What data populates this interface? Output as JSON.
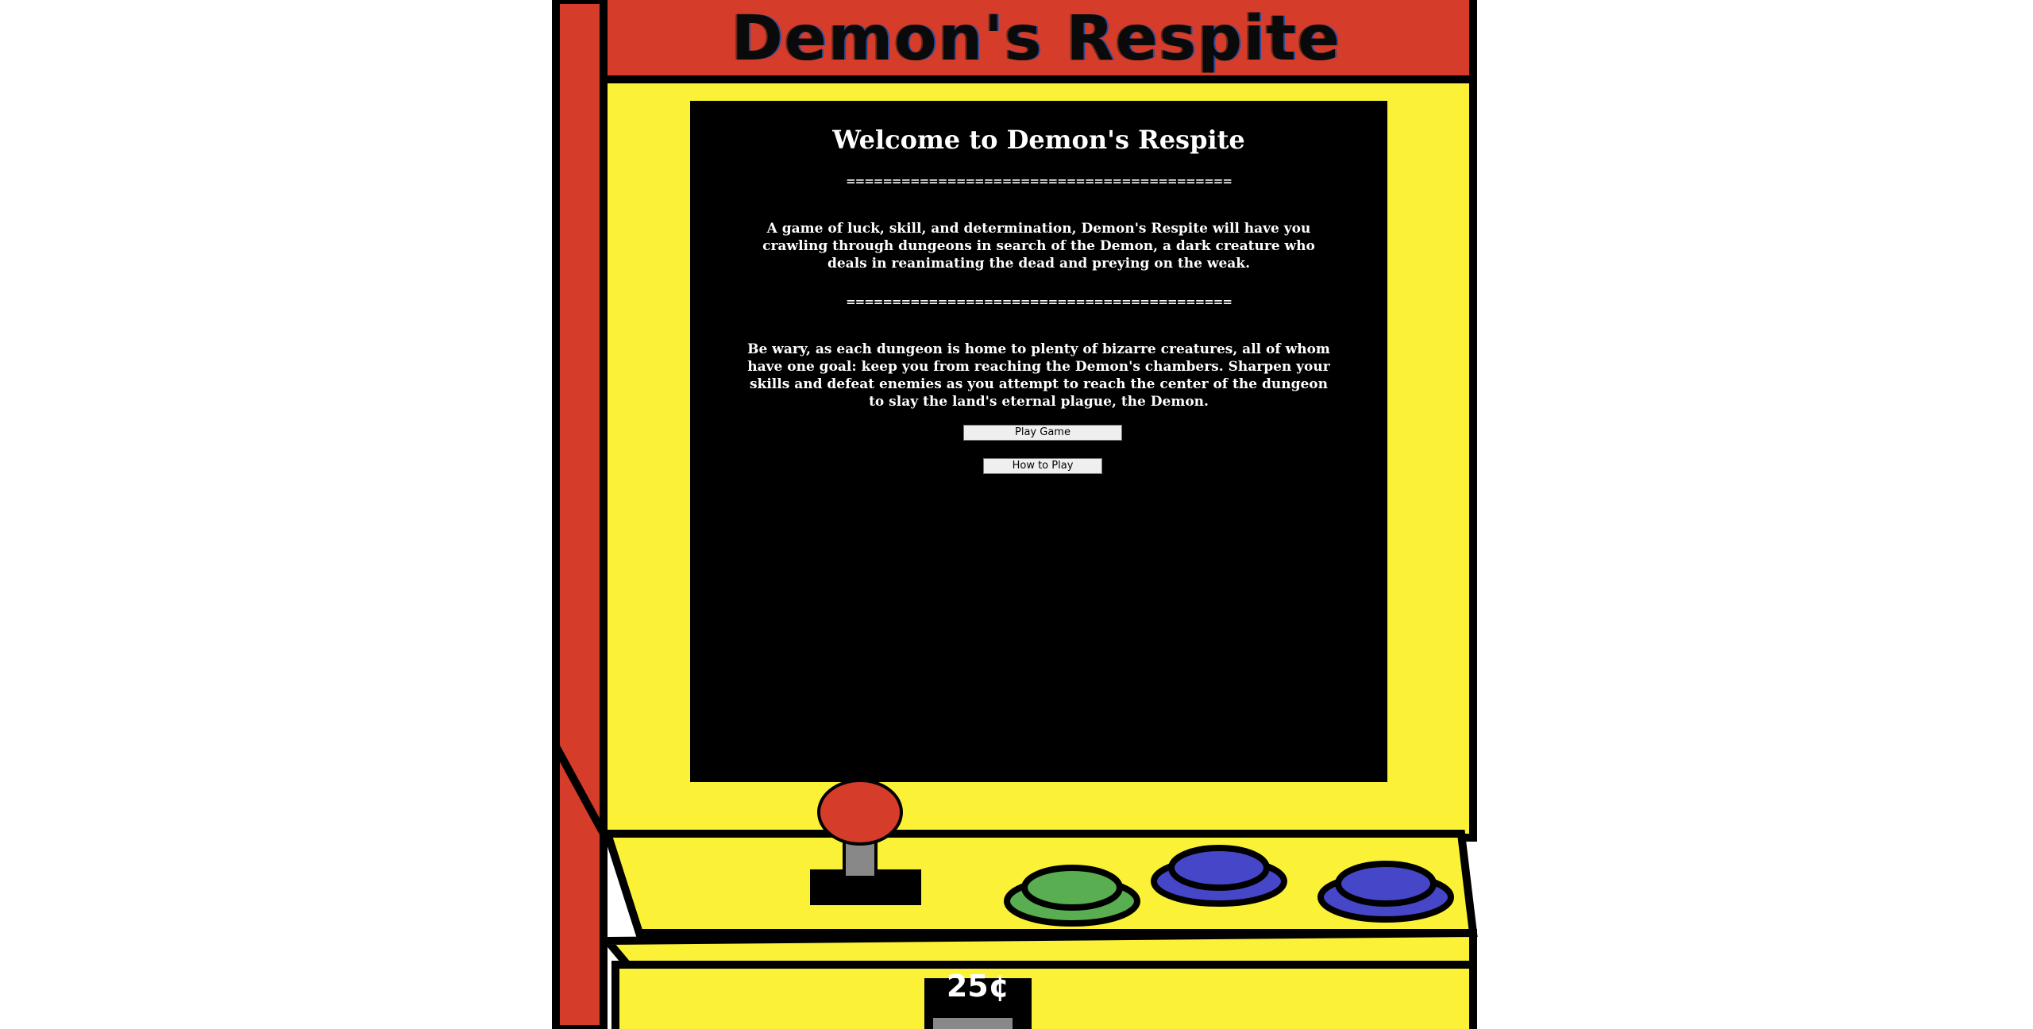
{
  "marquee": {
    "title": "Demon's Respite"
  },
  "screen": {
    "heading": "Welcome to Demon's Respite",
    "divider": "==========================================",
    "intro": "A game of luck, skill, and determination, Demon's Respite will have you crawling through dungeons in search of the Demon, a dark creature who deals in reanimating the dead and preying on the weak.",
    "warning": "Be wary, as each dungeon is home to plenty of bizarre creatures, all of whom have one goal: keep you from reaching the Demon's chambers. Sharpen your skills and defeat enemies as you attempt to reach the center of the dungeon to slay the land's eternal plague, the Demon.",
    "buttons": {
      "play": "Play Game",
      "how_to": "How to Play"
    }
  },
  "coin": {
    "label": "25¢"
  },
  "colors": {
    "cabinet_red": "#d63c2a",
    "cabinet_yellow": "#fbf237",
    "outline": "#000000",
    "joystick_ball": "#d63c2a",
    "button_green": "#58ae50",
    "button_blue": "#4646c8"
  },
  "icons": [
    "joystick-icon",
    "arcade-button-green",
    "arcade-button-blue",
    "arcade-button-blue"
  ]
}
